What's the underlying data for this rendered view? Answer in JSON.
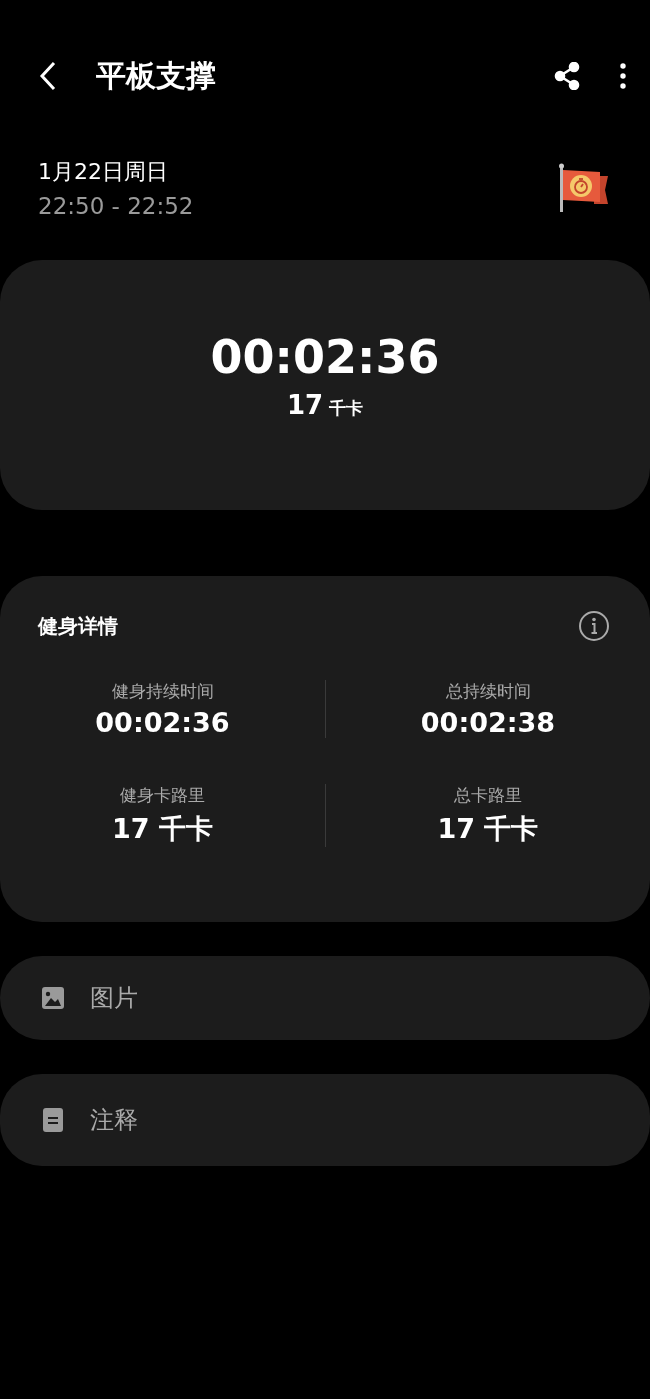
{
  "header": {
    "title": "平板支撑"
  },
  "session": {
    "date": "1月22日周日",
    "time_range": "22:50 - 22:52"
  },
  "summary": {
    "duration": "00:02:36",
    "calories": "17",
    "calories_unit": "千卡"
  },
  "details": {
    "title": "健身详情",
    "stats": [
      {
        "label": "健身持续时间",
        "value": "00:02:36"
      },
      {
        "label": "总持续时间",
        "value": "00:02:38"
      },
      {
        "label": "健身卡路里",
        "value": "17 千卡"
      },
      {
        "label": "总卡路里",
        "value": "17 千卡"
      }
    ]
  },
  "sections": [
    {
      "kind": "pictures",
      "label": "图片"
    },
    {
      "kind": "notes",
      "label": "注释"
    }
  ]
}
